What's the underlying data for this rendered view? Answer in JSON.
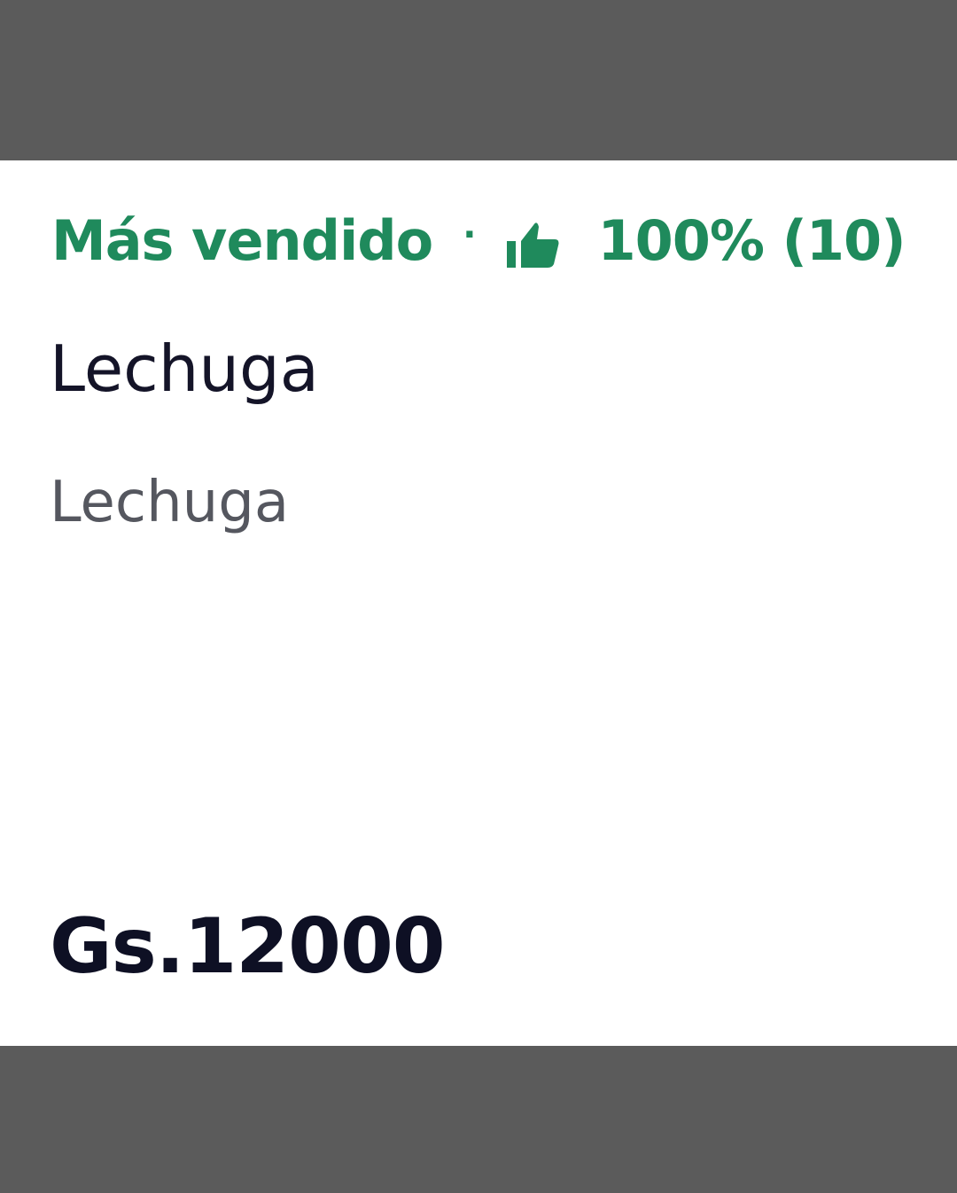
{
  "product_card": {
    "badge_label": "Más vendido",
    "separator": "·",
    "rating_icon": "thumbs-up-icon",
    "rating_text": "100% (10)",
    "name": "Lechuga",
    "description": "Lechuga",
    "price": "Gs.12000"
  },
  "colors": {
    "accent_green": "#1f8a5c",
    "frame_gray": "#5b5b5b",
    "title_text": "#141428",
    "desc_text": "#55575f"
  }
}
